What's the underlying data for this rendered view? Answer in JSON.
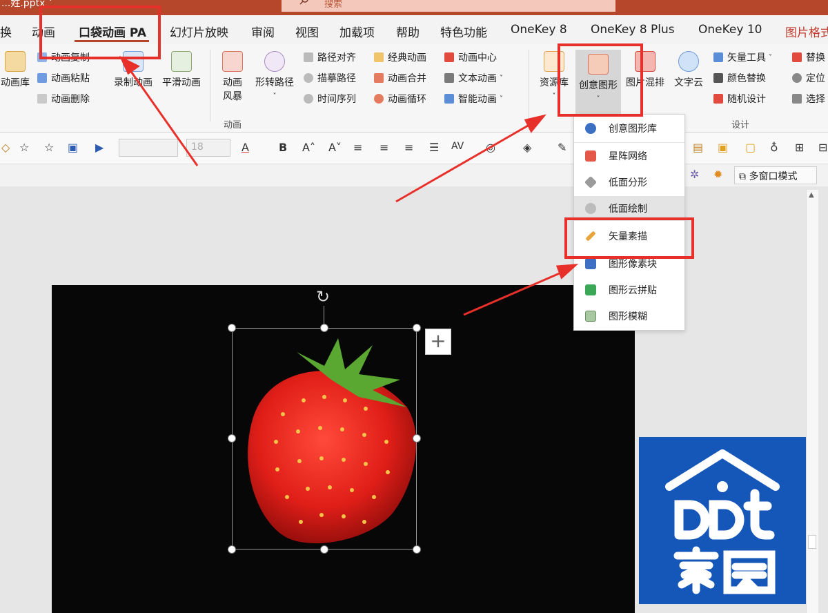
{
  "titlebar": {
    "title": "...姓.pptx ˅",
    "search_placeholder": "搜索"
  },
  "tabs": [
    {
      "label": "换"
    },
    {
      "label": "动画"
    },
    {
      "label": "口袋动画 PA"
    },
    {
      "label": "幻灯片放映"
    },
    {
      "label": "审阅"
    },
    {
      "label": "视图"
    },
    {
      "label": "加载项"
    },
    {
      "label": "帮助"
    },
    {
      "label": "特色功能"
    },
    {
      "label": "OneKey 8"
    },
    {
      "label": "OneKey 8 Plus"
    },
    {
      "label": "OneKey 10"
    },
    {
      "label": "图片格式"
    }
  ],
  "ribbon": {
    "anim_lib": "动画库",
    "anim_copy": "动画复制",
    "anim_paste": "动画粘贴",
    "anim_delete": "动画删除",
    "record_anim": "录制动画",
    "smooth_anim": "平滑动画",
    "anim_style_1": "动画",
    "anim_style_2": "风暴",
    "shape_path_1": "形转路径",
    "path_align": "路径对齐",
    "trace_path": "描摹路径",
    "time_sequence": "时间序列",
    "classic_anim": "经典动画",
    "anim_merge": "动画合并",
    "anim_loop": "动画循环",
    "anim_center": "动画中心",
    "text_anim": "文本动画",
    "smart_anim": "智能动画",
    "group_anim": "动画",
    "resource_lib": "资源库",
    "creative_shape": "创意图形",
    "pic_layout": "图片混排",
    "word_cloud": "文字云",
    "vector_tools": "矢量工具",
    "color_replace": "颜色替换",
    "random_design": "随机设计",
    "replace": "替换",
    "locate": "定位",
    "select": "选择",
    "group_design": "设计"
  },
  "fmtbar": {
    "font_size": "18",
    "bold": "B",
    "font_a": "A",
    "av": "AV"
  },
  "strip2": {
    "multiwindow": "多窗口模式"
  },
  "menu": {
    "items": [
      {
        "label": "创意图形库"
      },
      {
        "label": "星阵网络"
      },
      {
        "label": "低面分形"
      },
      {
        "label": "低面绘制"
      },
      {
        "label": "矢量素描"
      },
      {
        "label": "图形像素块"
      },
      {
        "label": "图形云拼贴"
      },
      {
        "label": "图形模糊"
      }
    ]
  },
  "slide": {
    "plus": "+"
  },
  "colors": {
    "accent": "#b7472a",
    "callout": "#e8302a",
    "logo_bg": "#1557b8"
  }
}
